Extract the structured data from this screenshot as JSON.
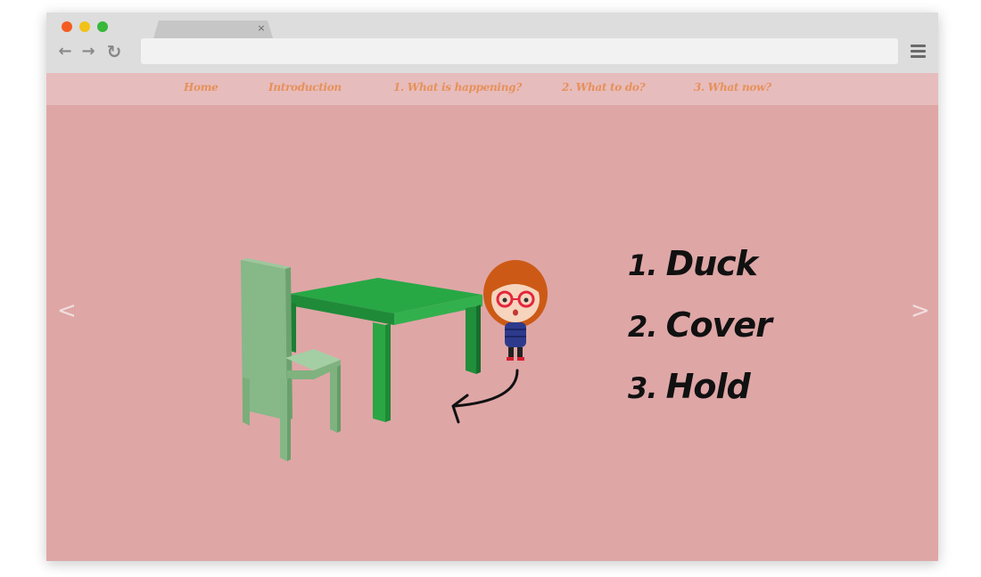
{
  "browser": {
    "tab_close": "×",
    "back_icon": "←",
    "forward_icon": "→",
    "reload_icon": "↻",
    "url": ""
  },
  "nav": {
    "items": [
      "Home",
      "Introduction",
      "1. What is happening?",
      "2. What to do?",
      "3. What now?"
    ]
  },
  "slider": {
    "prev": "<",
    "next": ">"
  },
  "steps": [
    {
      "number": "1.",
      "text": "Duck"
    },
    {
      "number": "2.",
      "text": "Cover"
    },
    {
      "number": "3.",
      "text": "Hold"
    }
  ],
  "colors": {
    "page_bg": "#dfa6a6",
    "nav_bg": "#e7bcbc",
    "nav_text": "#e6915a",
    "table": "#27a845",
    "chair": "#86b888"
  }
}
